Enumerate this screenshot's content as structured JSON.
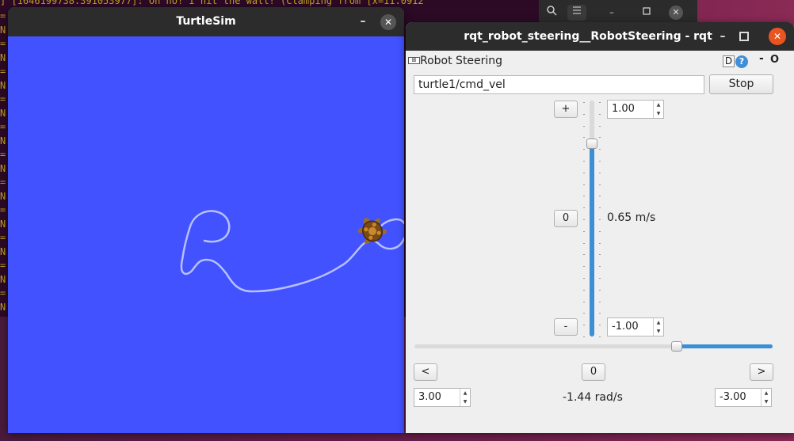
{
  "terminal": {
    "top_line": "] [1646199738.391053977]: Oh no! I hit the wall! (Clamping from [x=11.0912",
    "gutter_text": "=\nN\n=\nN\n=\nN\n=\nN\n=\nN\n=\nN\n=\nN\n=\nN\n=\nN\n=\nN\n=\nN\n=\nN",
    "buttons": [
      "search-icon",
      "menu-icon",
      "minimize-icon",
      "maximize-icon",
      "close-icon"
    ]
  },
  "turtlesim": {
    "title": "TurtleSim",
    "minimize": "–",
    "close": "✕",
    "background_color": "#4152fe",
    "trail_color": "#b8c0ff"
  },
  "rqt": {
    "title": "rqt_robot_steering__RobotSteering - rqt",
    "minimize": "–",
    "close": "✕",
    "plugin_title": "Robot Steering",
    "plugin_icon": "⊞",
    "header_d": "D",
    "header_help": "?",
    "header_dash": "-",
    "header_o": "O",
    "topic_value": "turtle1/cmd_vel",
    "stop_label": "Stop",
    "linear": {
      "plus_label": "+",
      "zero_label": "0",
      "minus_label": "-",
      "max_value": "1.00",
      "min_value": "-1.00",
      "current_label": "0.65 m/s",
      "slider_fraction": 0.825
    },
    "angular": {
      "left_label": "<",
      "zero_label": "0",
      "right_label": ">",
      "max_value": "3.00",
      "min_value": "-3.00",
      "current_label": "-1.44 rad/s",
      "slider_fraction": 0.74
    },
    "accent_color": "#3a8fd6",
    "close_color": "#e95420"
  }
}
